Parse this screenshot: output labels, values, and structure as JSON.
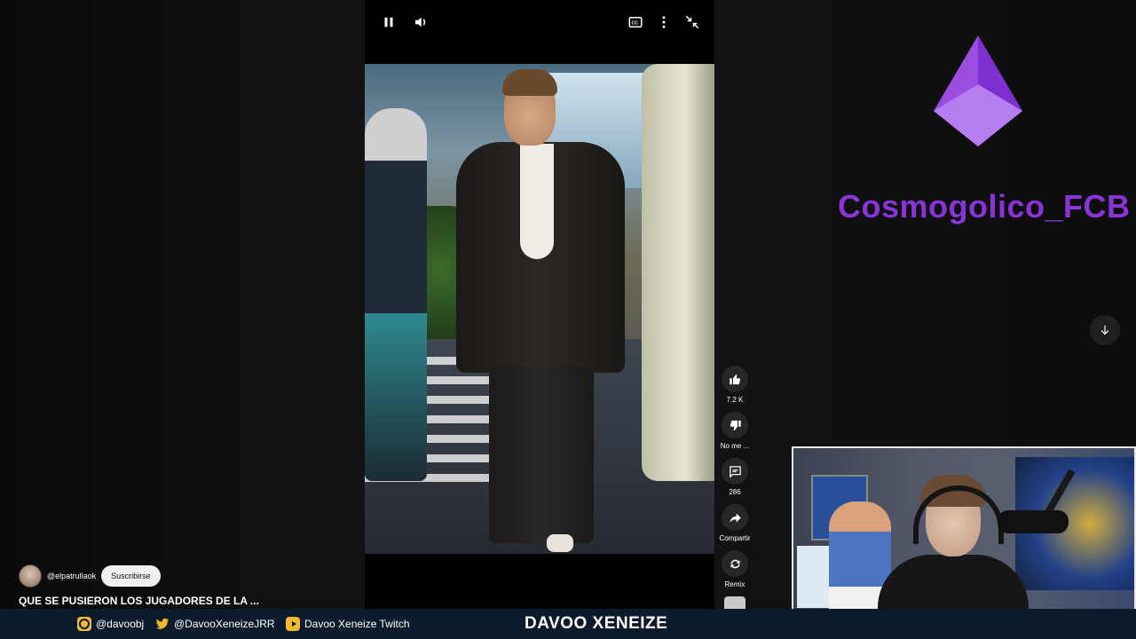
{
  "player": {
    "controls": {
      "pause_icon": "pause-icon",
      "volume_icon": "volume-icon",
      "cc_icon": "cc-icon",
      "more_icon": "more-vert-icon",
      "exit_fullscreen_icon": "exit-fullscreen-icon"
    }
  },
  "actions": {
    "like_label": "7.2 K",
    "dislike_label": "No me ...",
    "comments_label": "286",
    "share_label": "Compartir",
    "remix_label": "Remix"
  },
  "channel": {
    "handle": "@elpatrullaok",
    "subscribe_label": "Suscribirse"
  },
  "short": {
    "title": "QUE SE PUSIERON LOS JUGADORES DE LA ..."
  },
  "overlay": {
    "brand": "Cosmogolico_FCB",
    "brand_color": "#8a33d9"
  },
  "bottombar": {
    "instagram": "@davoobj",
    "twitter": "@DavooXeneizeJRR",
    "twitch": "Davoo Xeneize Twitch",
    "streamer": "DAVOO XENEIZE",
    "accent": "#f0b92f"
  }
}
